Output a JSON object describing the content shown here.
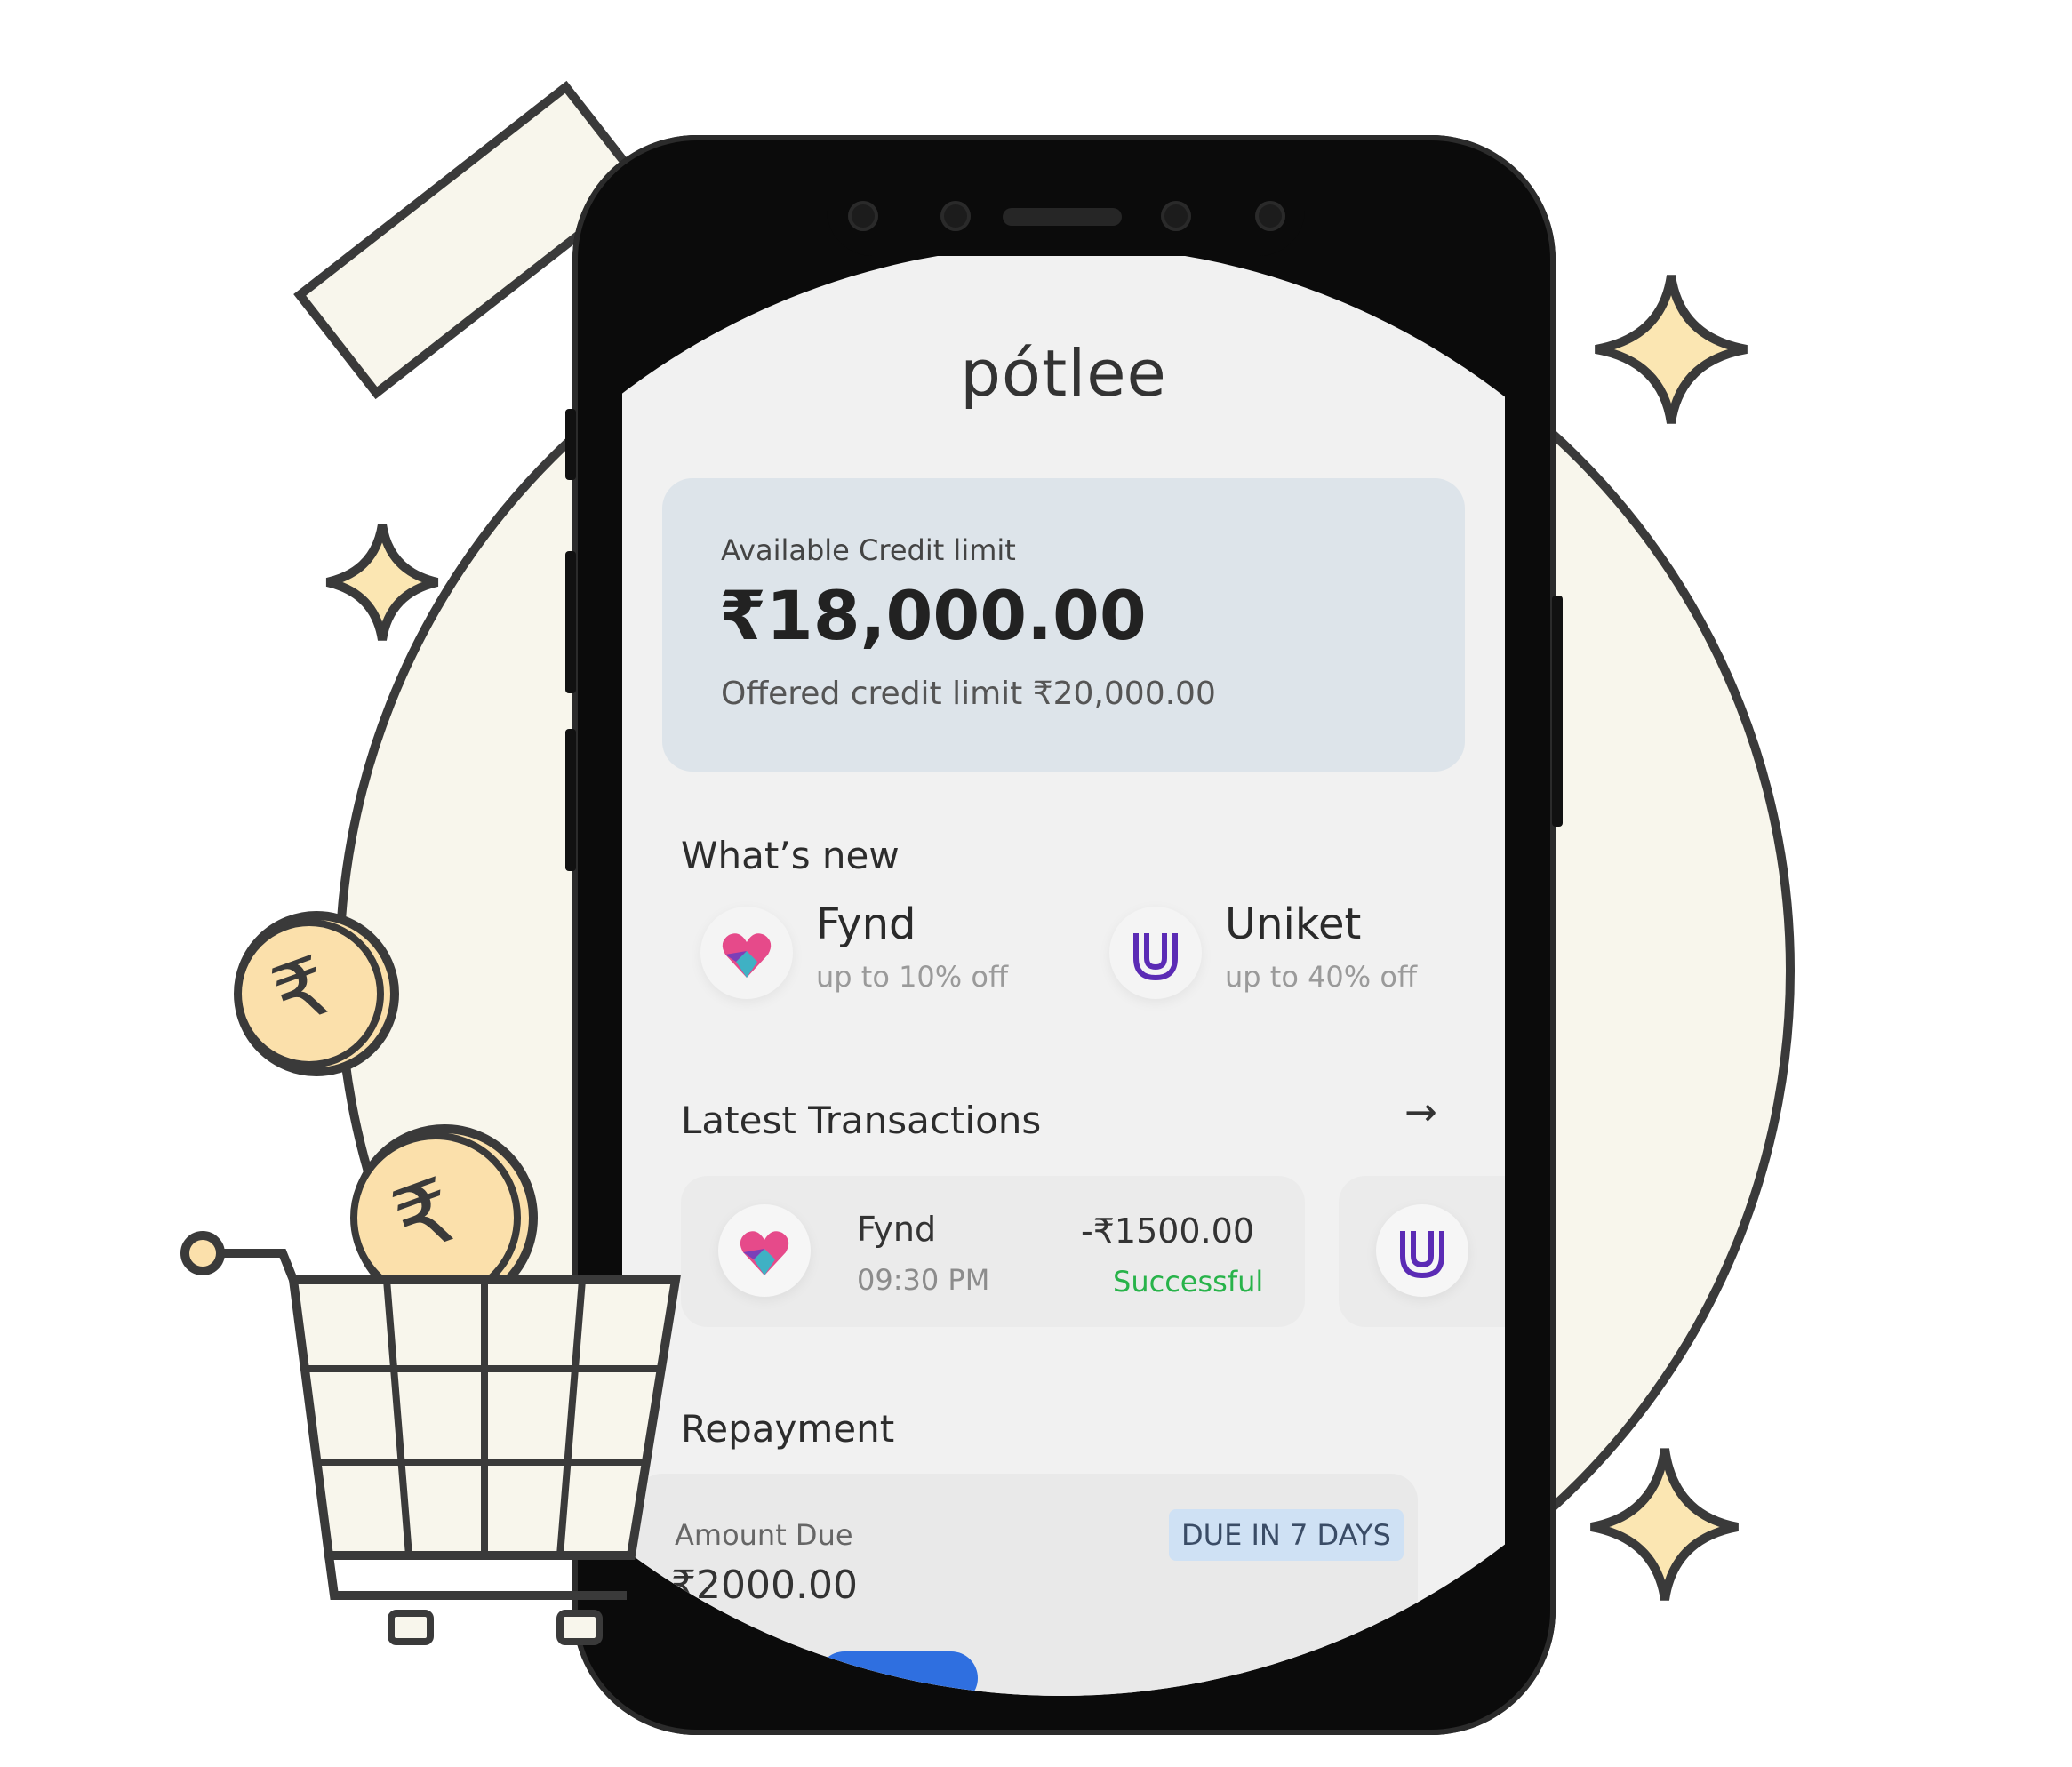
{
  "app": {
    "logo_text": "pótlee"
  },
  "credit": {
    "label": "Available Credit limit",
    "amount": "₹18,000.00",
    "offered_text": "Offered credit limit  ₹20,000.00"
  },
  "whats_new": {
    "title": "What’s new",
    "items": [
      {
        "name": "Fynd",
        "offer": "up to 10% off",
        "icon": "fynd-heart-icon"
      },
      {
        "name": "Uniket",
        "offer": "up to 40% off",
        "icon": "uniket-u-icon"
      }
    ]
  },
  "transactions": {
    "title": "Latest Transactions",
    "items": [
      {
        "name": "Fynd",
        "time": "09:30 PM",
        "amount": "-₹1500.00",
        "status": "Successful"
      }
    ]
  },
  "repayment": {
    "title": "Repayment",
    "label": "Amount Due",
    "amount": "₹2000.00",
    "badge": "DUE IN 7 DAYS"
  },
  "icons": {
    "rupee_coin": "₹",
    "arrow": "→"
  },
  "colors": {
    "background_circle": "#f8f6ec",
    "outline": "#3a3a3a",
    "sparkle": "#fbe6b2",
    "coin": "#fbe0ab",
    "card_blue": "#dde4ea",
    "success_green": "#28b34a",
    "fynd_pink": "#e64a8a",
    "uniket_purple": "#5b2bb5"
  }
}
